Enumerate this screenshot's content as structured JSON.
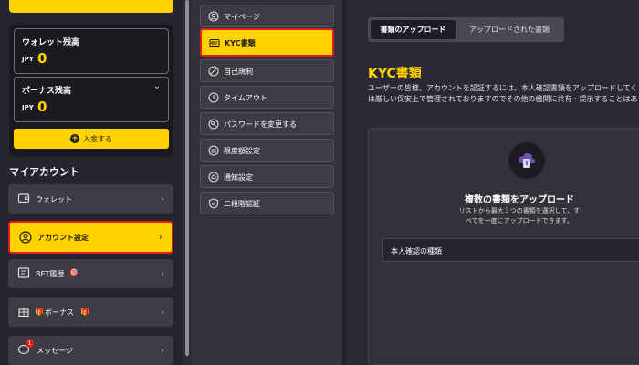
{
  "left": {
    "top_button_text": "",
    "wallet_balance": {
      "label": "ウォレット残高",
      "currency": "JPY",
      "amount": "0"
    },
    "bonus_balance": {
      "label": "ボーナス残高",
      "currency": "JPY",
      "amount": "0",
      "chevron": "⌄"
    },
    "deposit_label": "入金する",
    "section_title": "マイアカウント",
    "nav": [
      {
        "label": "ウォレット",
        "icon": "wallet-icon"
      },
      {
        "label": "アカウント設定",
        "icon": "user-icon"
      },
      {
        "label": "BET履歴",
        "icon": "bet-history-icon"
      },
      {
        "label": "ボーナス",
        "icon": "gift-icon"
      },
      {
        "label": "メッセージ",
        "icon": "message-icon",
        "badge": "1"
      }
    ],
    "arrow": "›"
  },
  "middle": {
    "items": [
      {
        "label": "マイページ",
        "icon": "user-circle-icon"
      },
      {
        "label": "KYC書類",
        "icon": "id-card-icon"
      },
      {
        "label": "自己規制",
        "icon": "no-entry-icon"
      },
      {
        "label": "タイムアウト",
        "icon": "clock-icon"
      },
      {
        "label": "パスワードを変更する",
        "icon": "key-icon"
      },
      {
        "label": "限度額設定",
        "icon": "limit-icon"
      },
      {
        "label": "通知設定",
        "icon": "bell-icon"
      },
      {
        "label": "二段階認証",
        "icon": "shield-icon"
      }
    ]
  },
  "right": {
    "tabs": [
      "書類のアップロード",
      "アップロードされた書類"
    ],
    "title": "KYC書類",
    "desc_line1": "ユーザーの皆様、アカウントを認証するには、本人確認書類をアップロードしてく",
    "desc_line2": "は厳しい保安上で管理されておりますのでその他の機関に共有・提示することはあ",
    "upload_title": "複数の書類をアップロード",
    "upload_sub1": "リストから最大３つの書類を選択して、す",
    "upload_sub2": "べてを一度にアップロードできます。",
    "select_label": "本人確認の種類"
  },
  "colors": {
    "accent": "#ffd200",
    "highlight": "#e41e1e"
  }
}
